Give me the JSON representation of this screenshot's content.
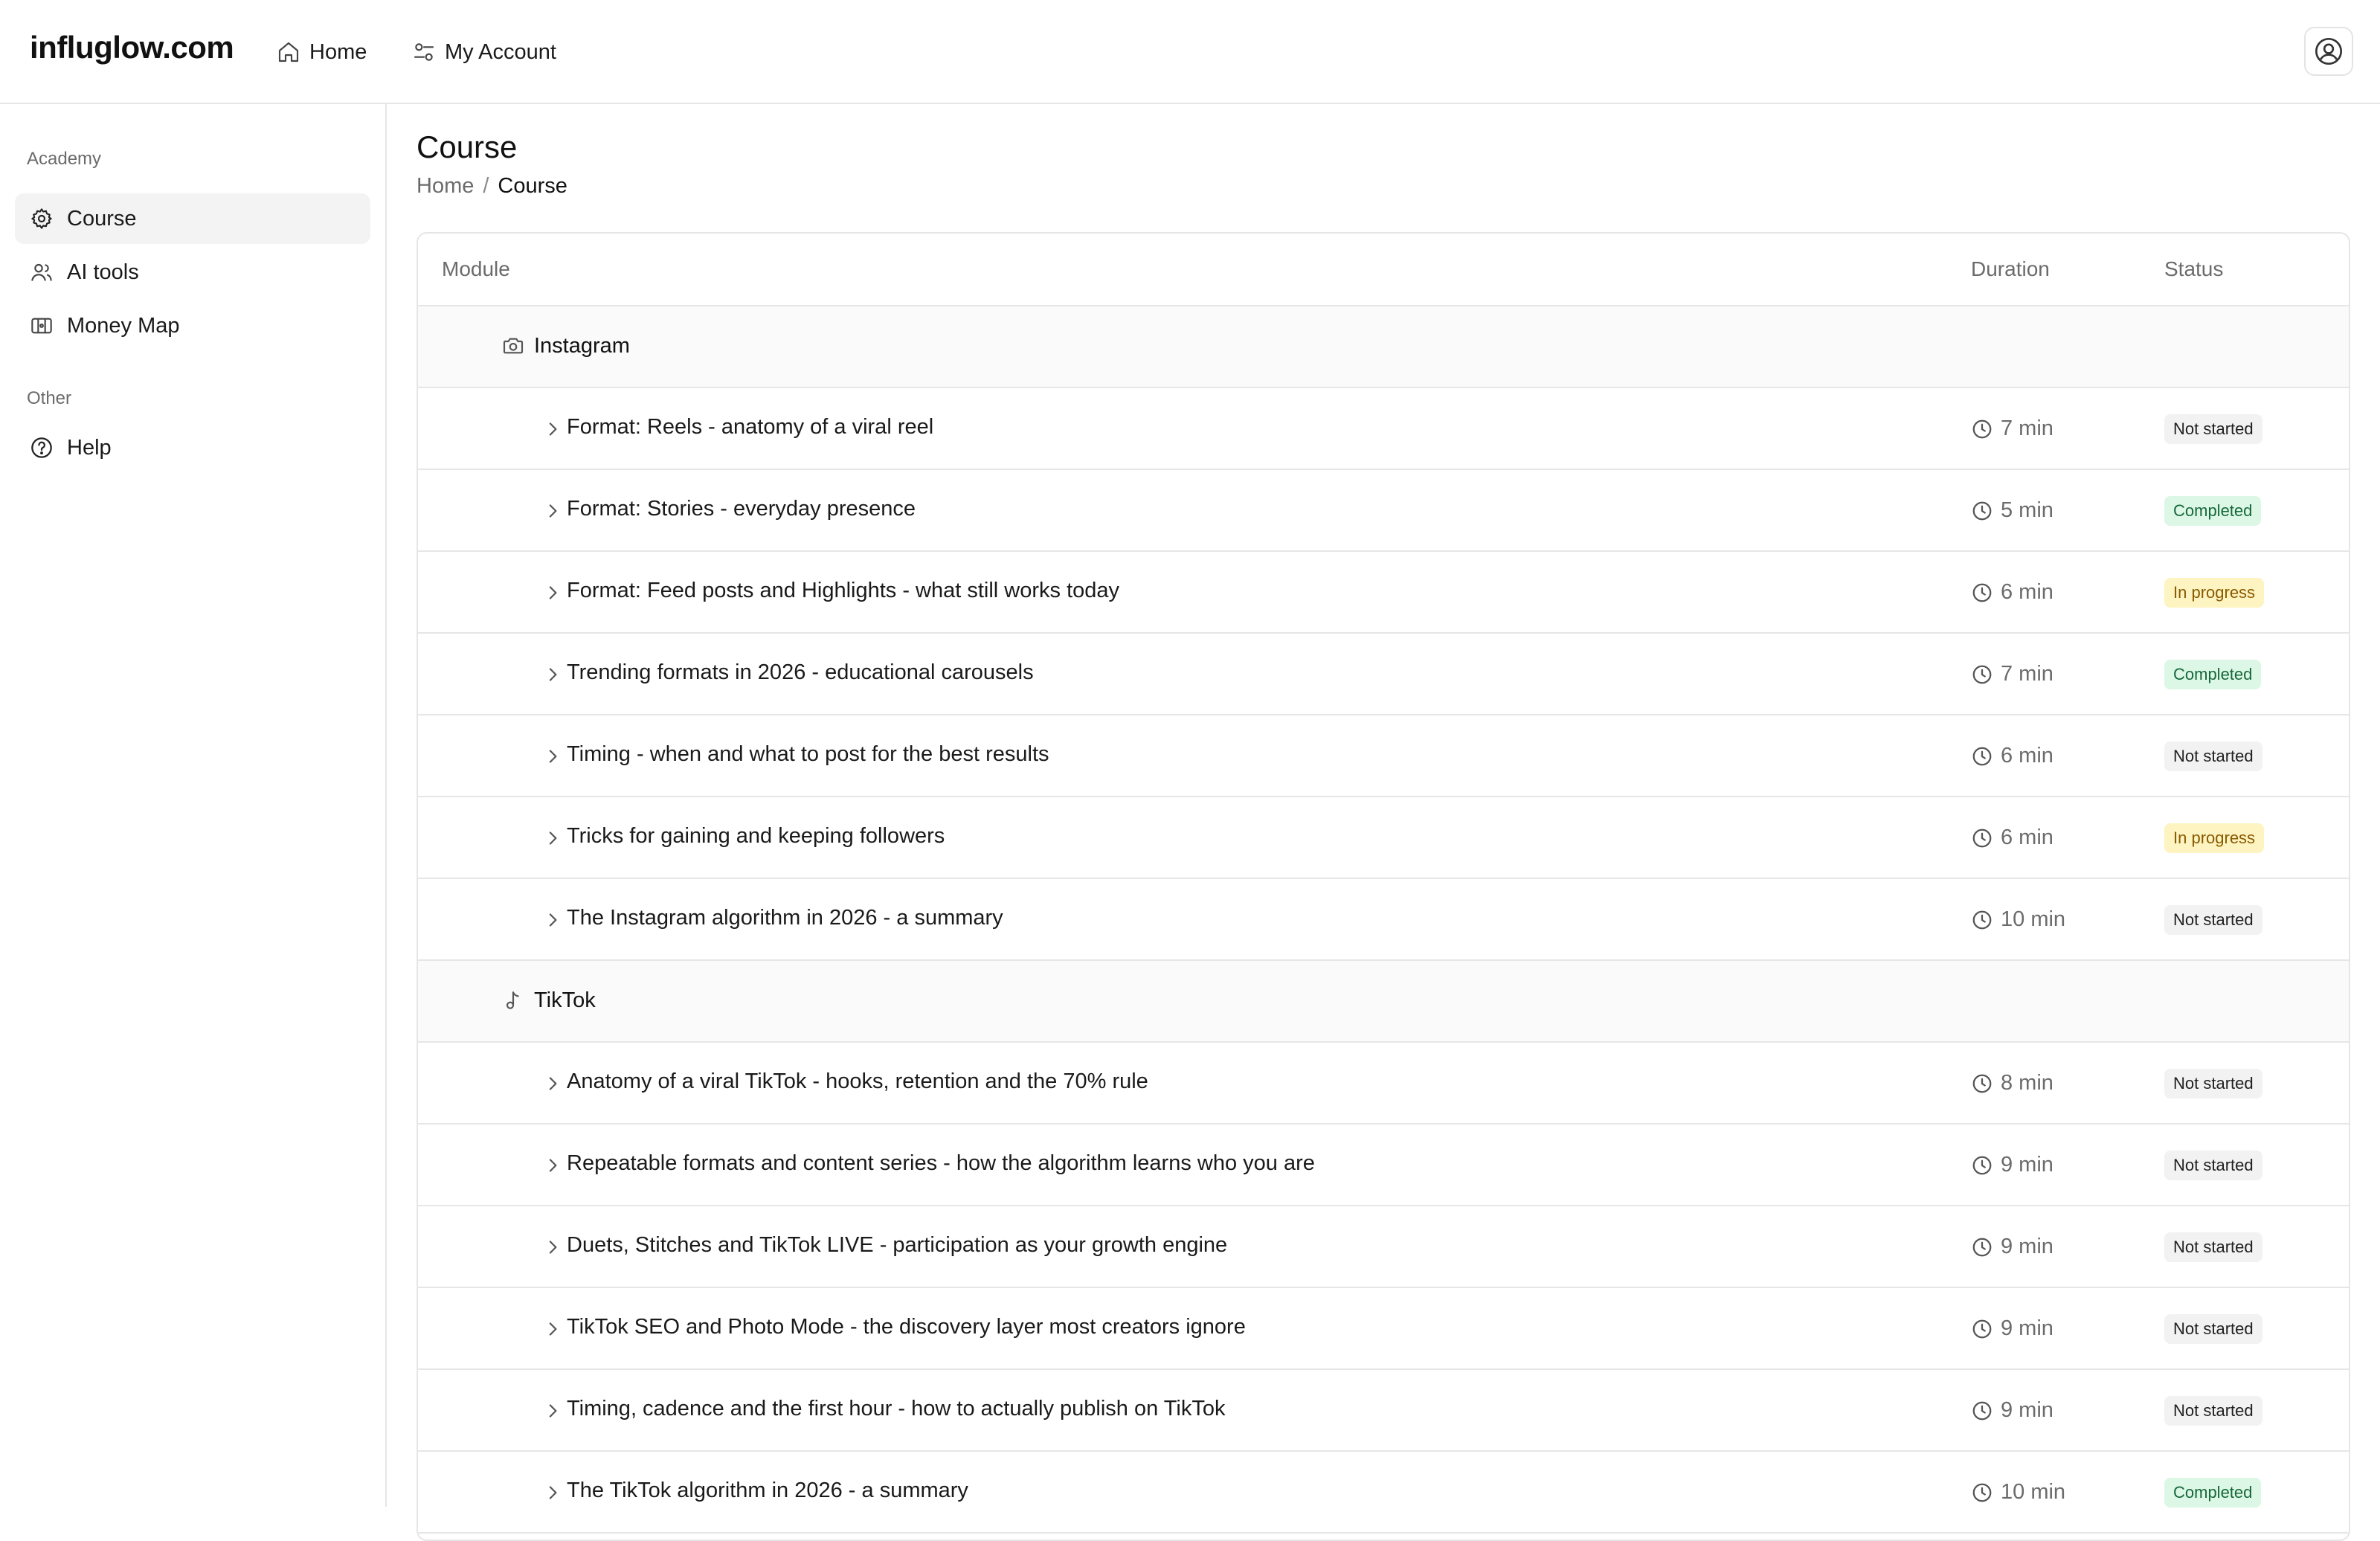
{
  "header": {
    "brand": "influglow.com",
    "nav": [
      {
        "label": "Home",
        "icon": "home-icon"
      },
      {
        "label": "My Account",
        "icon": "account-settings-icon"
      }
    ],
    "user_icon": "user-circle-icon"
  },
  "sidebar": {
    "sections": [
      {
        "title": "Academy",
        "items": [
          {
            "label": "Course",
            "icon": "gear-icon",
            "active": true
          },
          {
            "label": "AI tools",
            "icon": "users-icon",
            "active": false
          },
          {
            "label": "Money Map",
            "icon": "map-icon",
            "active": false
          }
        ]
      },
      {
        "title": "Other",
        "items": [
          {
            "label": "Help",
            "icon": "help-circle-icon",
            "active": false
          }
        ]
      }
    ]
  },
  "page": {
    "title": "Course",
    "breadcrumb": {
      "home": "Home",
      "separator": "/",
      "current": "Course"
    }
  },
  "table": {
    "columns": {
      "module": "Module",
      "duration": "Duration",
      "status": "Status"
    },
    "groups": [
      {
        "name": "Instagram",
        "icon": "camera-icon",
        "lessons": [
          {
            "title": "Format: Reels - anatomy of a viral reel",
            "duration": "7 min",
            "status": "Not started"
          },
          {
            "title": "Format: Stories - everyday presence",
            "duration": "5 min",
            "status": "Completed"
          },
          {
            "title": "Format: Feed posts and Highlights - what still works today",
            "duration": "6 min",
            "status": "In progress"
          },
          {
            "title": "Trending formats in 2026 - educational carousels",
            "duration": "7 min",
            "status": "Completed"
          },
          {
            "title": "Timing - when and what to post for the best results",
            "duration": "6 min",
            "status": "Not started"
          },
          {
            "title": "Tricks for gaining and keeping followers",
            "duration": "6 min",
            "status": "In progress"
          },
          {
            "title": "The Instagram algorithm in 2026 - a summary",
            "duration": "10 min",
            "status": "Not started"
          }
        ]
      },
      {
        "name": "TikTok",
        "icon": "music-note-icon",
        "lessons": [
          {
            "title": "Anatomy of a viral TikTok - hooks, retention and the 70% rule",
            "duration": "8 min",
            "status": "Not started"
          },
          {
            "title": "Repeatable formats and content series - how the algorithm learns who you are",
            "duration": "9 min",
            "status": "Not started"
          },
          {
            "title": "Duets, Stitches and TikTok LIVE - participation as your growth engine",
            "duration": "9 min",
            "status": "Not started"
          },
          {
            "title": "TikTok SEO and Photo Mode - the discovery layer most creators ignore",
            "duration": "9 min",
            "status": "Not started"
          },
          {
            "title": "Timing, cadence and the first hour - how to actually publish on TikTok",
            "duration": "9 min",
            "status": "Not started"
          },
          {
            "title": "The TikTok algorithm in 2026 - a summary",
            "duration": "10 min",
            "status": "Completed"
          }
        ]
      }
    ]
  },
  "colors": {
    "completed_bg": "#dcf7e5",
    "completed_text": "#16683b",
    "in_progress_bg": "#fdf4c2",
    "in_progress_text": "#8a5a00",
    "not_started_bg": "#f2f2f2",
    "not_started_text": "#1f1f1f"
  }
}
